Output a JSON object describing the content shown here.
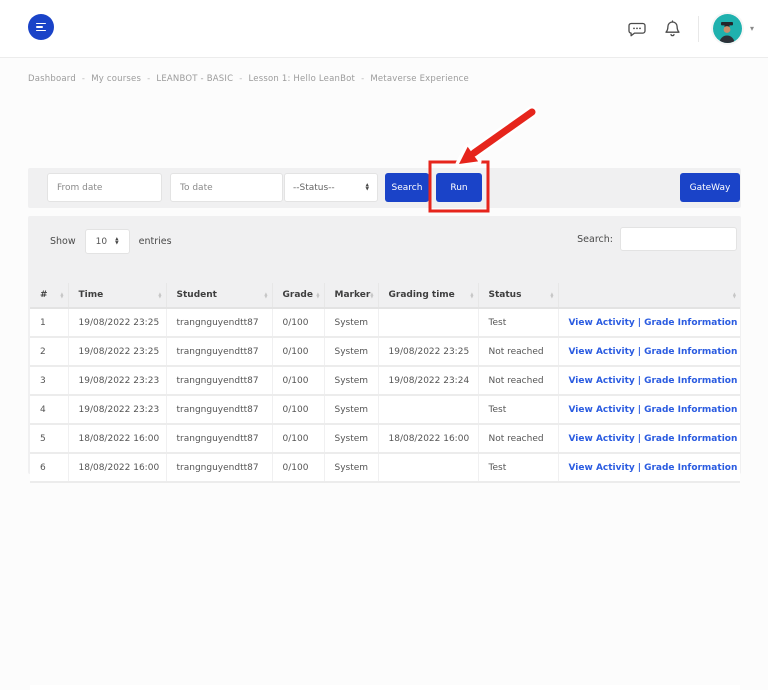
{
  "colors": {
    "primary": "#1a43c8",
    "link": "#2b5ce1",
    "annotation_red": "#e6251c",
    "avatar_bg": "#1fb1ae"
  },
  "header": {
    "logo_icon": "menu-list-icon",
    "chat_icon": "chat-bubble-icon",
    "bell_icon": "notification-bell-icon",
    "avatar_icon": "graduate-avatar",
    "caret": "▾"
  },
  "breadcrumb": {
    "separator": "-",
    "items": [
      "Dashboard",
      "My courses",
      "LEANBOT - BASIC",
      "Lesson 1: Hello LeanBot",
      "Metaverse Experience"
    ]
  },
  "filter_bar": {
    "from_date_placeholder": "From date",
    "to_date_placeholder": "To date",
    "status_value": "--Status--",
    "search_label": "Search",
    "run_label": "Run",
    "gateway_label": "GateWay"
  },
  "table_controls": {
    "show_label": "Show",
    "page_size": "10",
    "entries_label": "entries",
    "search_label": "Search:",
    "search_value": ""
  },
  "table": {
    "columns": [
      "#",
      "Time",
      "Student",
      "Grade",
      "Marker",
      "Grading time",
      "Status",
      ""
    ],
    "action_view": "View Activity",
    "action_separator": "|",
    "action_grade": "Grade Information",
    "rows": [
      {
        "num": "1",
        "time": "19/08/2022 23:25",
        "student": "trangnguyendtt87",
        "grade": "0/100",
        "marker": "System",
        "grading_time": "",
        "status": "Test"
      },
      {
        "num": "2",
        "time": "19/08/2022 23:25",
        "student": "trangnguyendtt87",
        "grade": "0/100",
        "marker": "System",
        "grading_time": "19/08/2022 23:25",
        "status": "Not reached"
      },
      {
        "num": "3",
        "time": "19/08/2022 23:23",
        "student": "trangnguyendtt87",
        "grade": "0/100",
        "marker": "System",
        "grading_time": "19/08/2022 23:24",
        "status": "Not reached"
      },
      {
        "num": "4",
        "time": "19/08/2022 23:23",
        "student": "trangnguyendtt87",
        "grade": "0/100",
        "marker": "System",
        "grading_time": "",
        "status": "Test"
      },
      {
        "num": "5",
        "time": "18/08/2022 16:00",
        "student": "trangnguyendtt87",
        "grade": "0/100",
        "marker": "System",
        "grading_time": "18/08/2022 16:00",
        "status": "Not reached"
      },
      {
        "num": "6",
        "time": "18/08/2022 16:00",
        "student": "trangnguyendtt87",
        "grade": "0/100",
        "marker": "System",
        "grading_time": "",
        "status": "Test"
      }
    ]
  }
}
